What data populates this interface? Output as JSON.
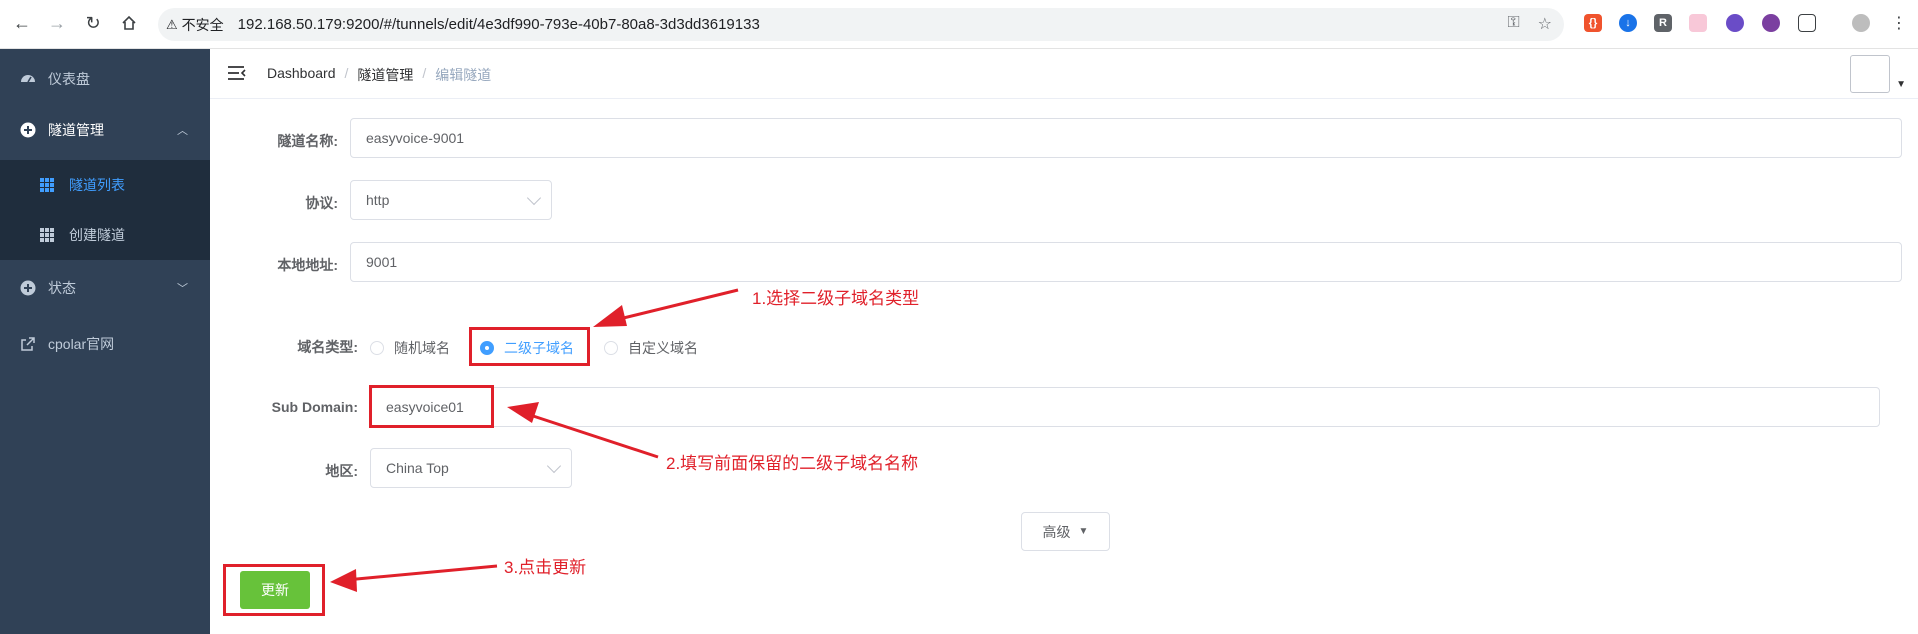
{
  "browser": {
    "insecure_label": "不安全",
    "url": "192.168.50.179:9200/#/tunnels/edit/4e3df990-793e-40b7-80a8-3d3dd3619133"
  },
  "sidebar": {
    "items": [
      {
        "label": "仪表盘",
        "icon": "dashboard-icon"
      },
      {
        "label": "隧道管理",
        "icon": "plus-circle-icon"
      },
      {
        "label": "状态",
        "icon": "plus-circle-icon"
      },
      {
        "label": "cpolar官网",
        "icon": "external-link-icon"
      }
    ],
    "sub_items": [
      {
        "label": "隧道列表",
        "icon": "table-icon",
        "active": true
      },
      {
        "label": "创建隧道",
        "icon": "table-icon",
        "active": false
      }
    ]
  },
  "breadcrumb": [
    "Dashboard",
    "隧道管理",
    "编辑隧道"
  ],
  "form": {
    "tunnel_name": {
      "label": "隧道名称:",
      "value": "easyvoice-9001"
    },
    "protocol": {
      "label": "协议:",
      "value": "http"
    },
    "local_addr": {
      "label": "本地地址:",
      "value": "9001"
    },
    "domain_type": {
      "label": "域名类型:",
      "options": [
        "随机域名",
        "二级子域名",
        "自定义域名"
      ],
      "selected": "二级子域名"
    },
    "sub_domain": {
      "label": "Sub Domain:",
      "value": "easyvoice01"
    },
    "region": {
      "label": "地区:",
      "value": "China Top"
    },
    "advanced_label": "高级",
    "update_label": "更新"
  },
  "annotations": {
    "step1": "1.选择二级子域名类型",
    "step2": "2.填写前面保留的二级子域名名称",
    "step3": "3.点击更新"
  },
  "colors": {
    "sidebar_bg": "#304156",
    "submenu_bg": "#1f2d3d",
    "accent": "#409eff",
    "success": "#67c23a",
    "annotation": "#e0202a"
  }
}
